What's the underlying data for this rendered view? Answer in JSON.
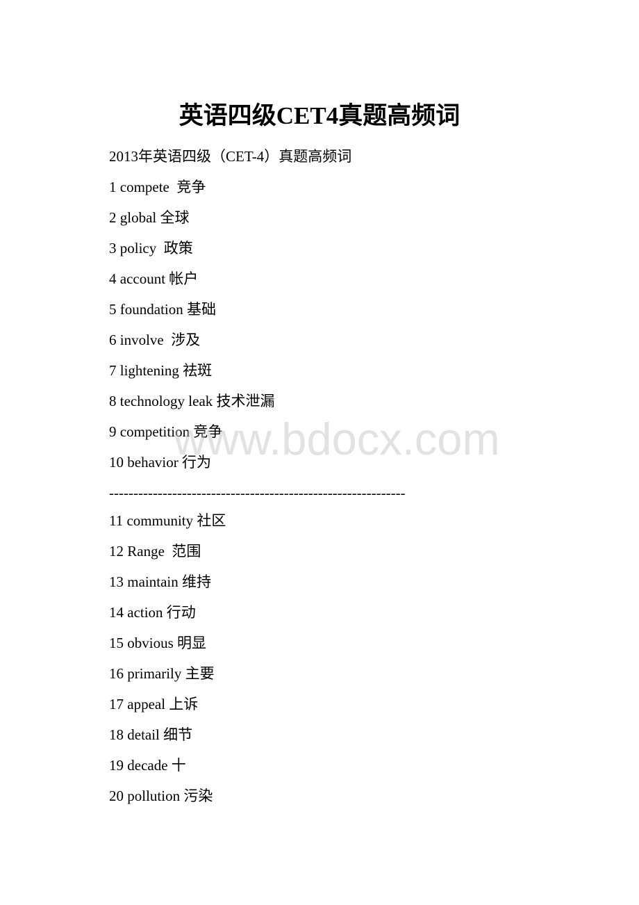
{
  "document": {
    "title": "英语四级CET4真题高频词",
    "subtitle": "2013年英语四级（CET-4）真题高频词",
    "separator": "-------------------------------------------------------------",
    "watermark": "www.bdocx.com",
    "words_part1": [
      {
        "num": "1",
        "en": "compete",
        "zh": "竞争",
        "text": "1 compete  竞争"
      },
      {
        "num": "2",
        "en": "global",
        "zh": "全球",
        "text": "2 global 全球"
      },
      {
        "num": "3",
        "en": "policy",
        "zh": "政策",
        "text": "3 policy  政策"
      },
      {
        "num": "4",
        "en": "account",
        "zh": "帐户",
        "text": "4 account 帐户"
      },
      {
        "num": "5",
        "en": "foundation",
        "zh": "基础",
        "text": "5 foundation 基础"
      },
      {
        "num": "6",
        "en": "involve",
        "zh": "涉及",
        "text": "6 involve  涉及"
      },
      {
        "num": "7",
        "en": "lightening",
        "zh": "祛斑",
        "text": "7 lightening 祛斑"
      },
      {
        "num": "8",
        "en": "technology leak",
        "zh": "技术泄漏",
        "text": "8 technology leak 技术泄漏"
      },
      {
        "num": "9",
        "en": "competition",
        "zh": "竞争",
        "text": "9 competition 竞争"
      },
      {
        "num": "10",
        "en": "behavior",
        "zh": "行为",
        "text": "10 behavior 行为"
      }
    ],
    "words_part2": [
      {
        "num": "11",
        "en": "community",
        "zh": "社区",
        "text": "11 community 社区"
      },
      {
        "num": "12",
        "en": "Range",
        "zh": "范围",
        "text": "12 Range  范围"
      },
      {
        "num": "13",
        "en": "maintain",
        "zh": "维持",
        "text": "13 maintain 维持"
      },
      {
        "num": "14",
        "en": "action",
        "zh": "行动",
        "text": "14 action 行动"
      },
      {
        "num": "15",
        "en": "obvious",
        "zh": "明显",
        "text": "15 obvious 明显"
      },
      {
        "num": "16",
        "en": "primarily",
        "zh": "主要",
        "text": "16 primarily 主要"
      },
      {
        "num": "17",
        "en": "appeal",
        "zh": "上诉",
        "text": "17 appeal 上诉"
      },
      {
        "num": "18",
        "en": "detail",
        "zh": "细节",
        "text": "18 detail 细节"
      },
      {
        "num": "19",
        "en": "decade",
        "zh": "十",
        "text": "19 decade 十"
      },
      {
        "num": "20",
        "en": "pollution",
        "zh": "污染",
        "text": "20 pollution 污染"
      }
    ]
  }
}
